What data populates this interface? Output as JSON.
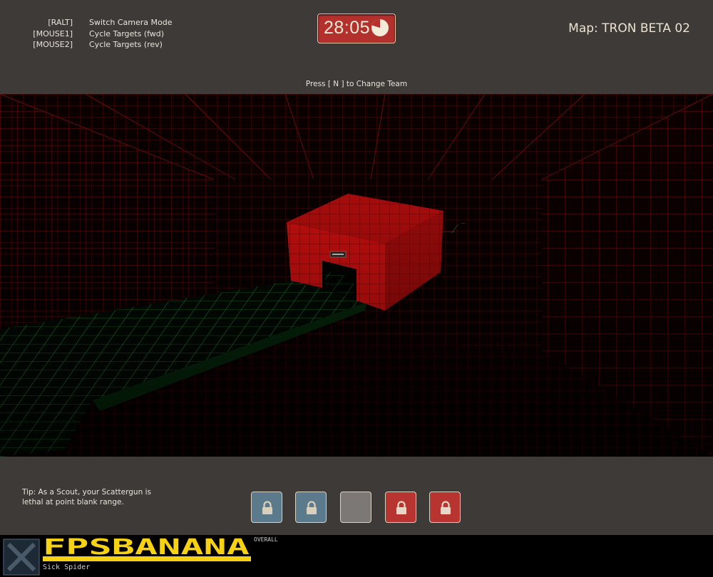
{
  "keybinds": [
    {
      "key": "[RALT]",
      "action": "Switch Camera Mode"
    },
    {
      "key": "[MOUSE1]",
      "action": "Cycle Targets (fwd)"
    },
    {
      "key": "[MOUSE2]",
      "action": "Cycle Targets (rev)"
    }
  ],
  "timer": {
    "value": "28:05",
    "clock_icon": "clock-icon",
    "color": "#b3302d"
  },
  "map": {
    "label": "Map: TRON BETA 02"
  },
  "team_hint": "Press [ N ] to Change Team",
  "tip": "Tip: As a Scout, your Scattergun is lethal at point blank range.",
  "class_buttons": [
    {
      "team": "blue",
      "icon": "lock-icon",
      "color": "#5b7a8c"
    },
    {
      "team": "blue",
      "icon": "lock-icon",
      "color": "#5b7a8c"
    },
    {
      "team": "neutral",
      "icon": "",
      "color": "#7b7875"
    },
    {
      "team": "red",
      "icon": "lock-icon",
      "color": "#b83430"
    },
    {
      "team": "red",
      "icon": "lock-icon",
      "color": "#b83430"
    }
  ],
  "footer": {
    "brand": "FPSBANANA",
    "tag": "OVERALL",
    "author": "Sick Spider",
    "brand_color": "#f7d214"
  },
  "scene": {
    "grid_wall_color": "#8a1010",
    "floor_grid_color": "#1a8a30",
    "building_color": "#d01010"
  }
}
